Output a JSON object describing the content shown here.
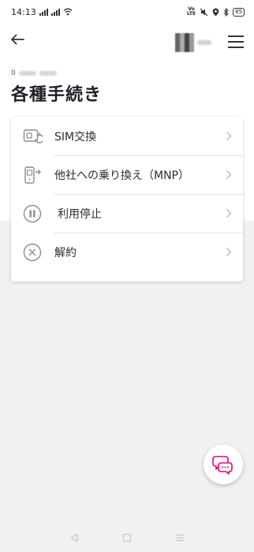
{
  "status_bar": {
    "time": "14:13",
    "volte": "VoLTE",
    "battery": "85"
  },
  "header": {
    "account_number_prefix": "0"
  },
  "page": {
    "title": "各種手続き"
  },
  "procedures": [
    {
      "label": "SIM交換",
      "icon": "sim-swap-icon"
    },
    {
      "label": "他社への乗り換え（MNP）",
      "icon": "phone-transfer-icon"
    },
    {
      "label": "利用停止",
      "icon": "pause-icon"
    },
    {
      "label": "解約",
      "icon": "cancel-icon"
    }
  ],
  "colors": {
    "accent": "#e6007e",
    "icon_gray": "#8a8a9a"
  }
}
